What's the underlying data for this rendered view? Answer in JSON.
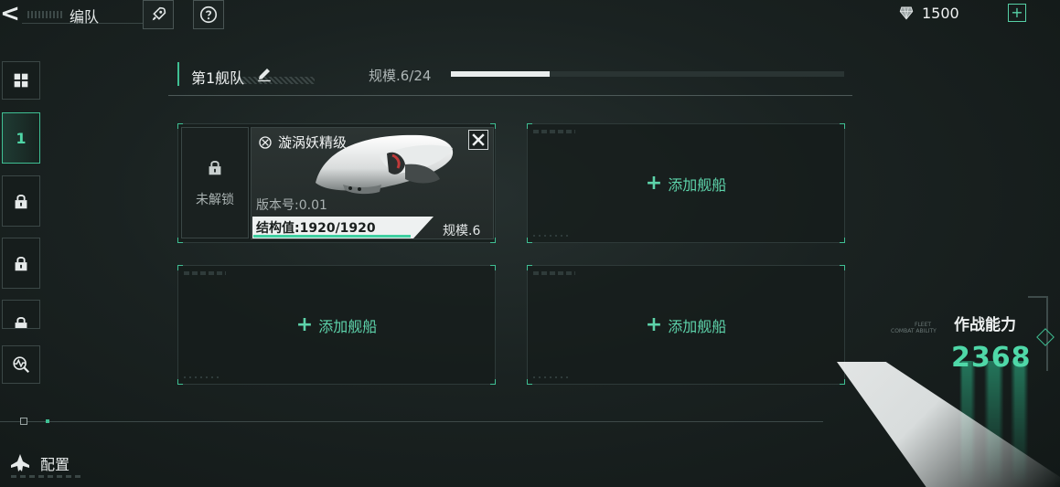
{
  "topbar": {
    "back_glyph": "<",
    "title": "编队",
    "icons": [
      "rocket-icon",
      "help-icon"
    ],
    "currency": {
      "icon": "crystal-icon",
      "amount": "1500",
      "add_glyph": "+"
    }
  },
  "sidebar": {
    "items": [
      {
        "type": "grid",
        "icon": "grid-icon"
      },
      {
        "type": "fleet",
        "label": "1",
        "active": true
      },
      {
        "type": "locked",
        "icon": "lock-icon"
      },
      {
        "type": "locked",
        "icon": "lock-icon"
      },
      {
        "type": "locked",
        "icon": "lock-icon"
      },
      {
        "type": "scan",
        "icon": "scan-search-icon"
      }
    ]
  },
  "fleet": {
    "name": "第1舰队",
    "scale_label": "规模.6/24",
    "scale_used": 6,
    "scale_max": 24
  },
  "slots": {
    "locked_label": "未解锁",
    "ship": {
      "name": "漩涡妖精级",
      "version": "版本号:0.01",
      "hp_label": "结构值:1920/1920",
      "hp_current": 1920,
      "hp_max": 1920,
      "scale": "规模.6"
    },
    "add_label": "添加舰船",
    "add_glyph": "+"
  },
  "combat": {
    "deco_line1": "FLEET",
    "deco_line2": "COMBAT ABILITY",
    "label": "作战能力",
    "value": "2368"
  },
  "bottom": {
    "config_label": "配置"
  },
  "colors": {
    "accent": "#3fbf93",
    "accent_text": "#5dd3aa",
    "background": "#1a2221"
  }
}
